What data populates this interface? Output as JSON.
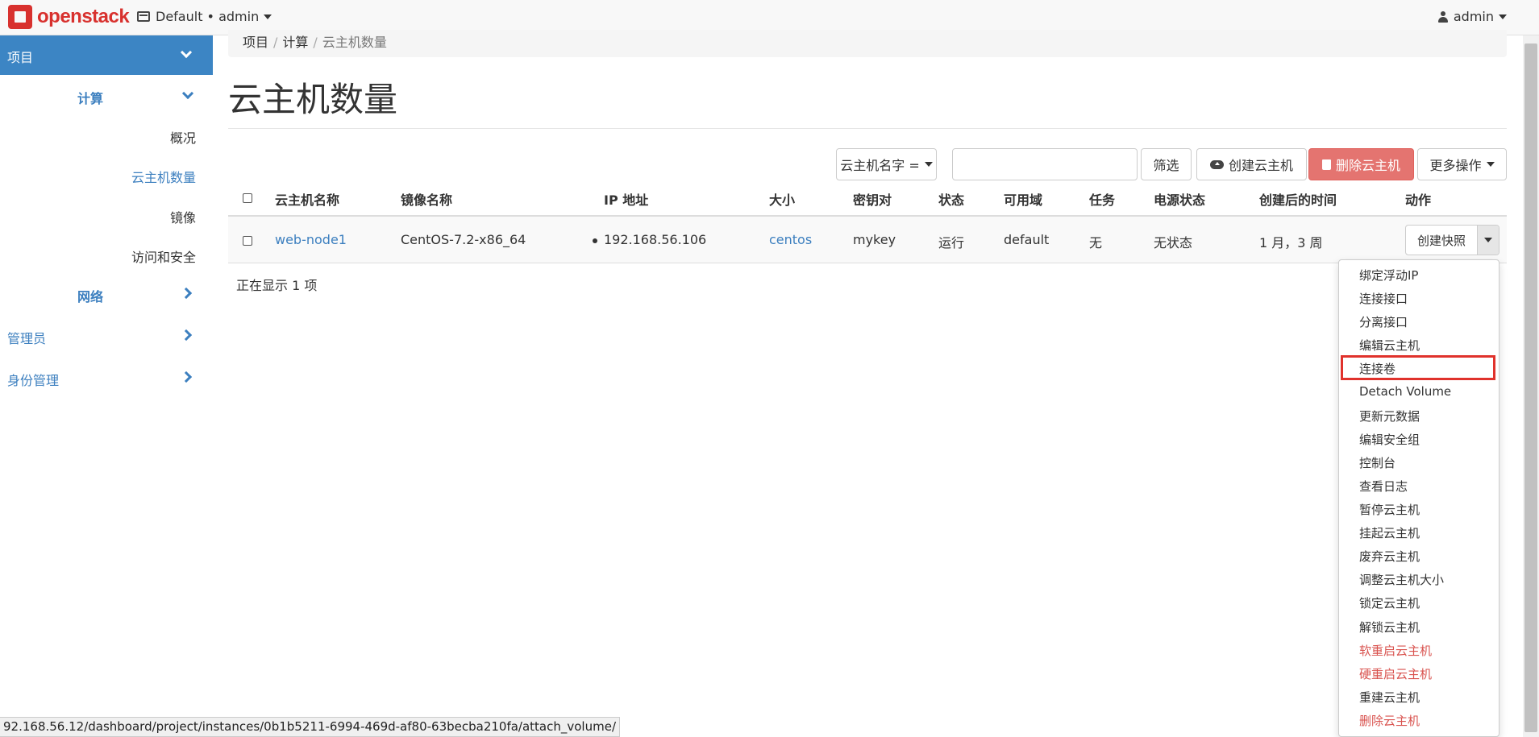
{
  "navbar": {
    "brand": "openstack",
    "project_picker": "Default • admin",
    "user": "admin"
  },
  "sidebar": {
    "project": "项目",
    "compute": "计算",
    "overview": "概况",
    "instances": "云主机数量",
    "images": "镜像",
    "access_security": "访问和安全",
    "network": "网络",
    "admin": "管理员",
    "identity": "身份管理"
  },
  "breadcrumb": {
    "items": [
      "项目",
      "计算"
    ],
    "current": "云主机数量"
  },
  "page_title": "云主机数量",
  "toolbar": {
    "filter_field": "云主机名字 =",
    "filter_value": "",
    "filter_button": "筛选",
    "create_button": "创建云主机",
    "delete_button": "删除云主机",
    "more_actions": "更多操作"
  },
  "table": {
    "headers": [
      "云主机名称",
      "镜像名称",
      "IP 地址",
      "大小",
      "密钥对",
      "状态",
      "可用域",
      "任务",
      "电源状态",
      "创建后的时间",
      "动作"
    ],
    "rows": [
      {
        "name": "web-node1",
        "image": "CentOS-7.2-x86_64",
        "ip": "192.168.56.106",
        "size": "centos",
        "keypair": "mykey",
        "status": "运行",
        "az": "default",
        "task": "无",
        "power": "无状态",
        "age": "1 月，3 周",
        "action": "创建快照"
      }
    ],
    "footer": "正在显示 1 项"
  },
  "dropdown": {
    "items": [
      {
        "label": "绑定浮动IP",
        "danger": false
      },
      {
        "label": "连接接口",
        "danger": false
      },
      {
        "label": "分离接口",
        "danger": false
      },
      {
        "label": "编辑云主机",
        "danger": false
      },
      {
        "label": "连接卷",
        "danger": false,
        "highlighted": true
      },
      {
        "label": "Detach Volume",
        "danger": false
      },
      {
        "label": "更新元数据",
        "danger": false
      },
      {
        "label": "编辑安全组",
        "danger": false
      },
      {
        "label": "控制台",
        "danger": false
      },
      {
        "label": "查看日志",
        "danger": false
      },
      {
        "label": "暂停云主机",
        "danger": false
      },
      {
        "label": "挂起云主机",
        "danger": false
      },
      {
        "label": "废弃云主机",
        "danger": false
      },
      {
        "label": "调整云主机大小",
        "danger": false
      },
      {
        "label": "锁定云主机",
        "danger": false
      },
      {
        "label": "解锁云主机",
        "danger": false
      },
      {
        "label": "软重启云主机",
        "danger": true
      },
      {
        "label": "硬重启云主机",
        "danger": true
      },
      {
        "label": "重建云主机",
        "danger": false
      },
      {
        "label": "删除云主机",
        "danger": true
      }
    ]
  },
  "status_bar": "92.168.56.12/dashboard/project/instances/0b1b5211-6994-469d-af80-63becba210fa/attach_volume/",
  "colors": {
    "brand": "#d8312e",
    "sidebar_active": "#3c85c4",
    "link": "#3c7fbf",
    "danger": "#d9534f",
    "highlight_box": "#e0322c"
  }
}
